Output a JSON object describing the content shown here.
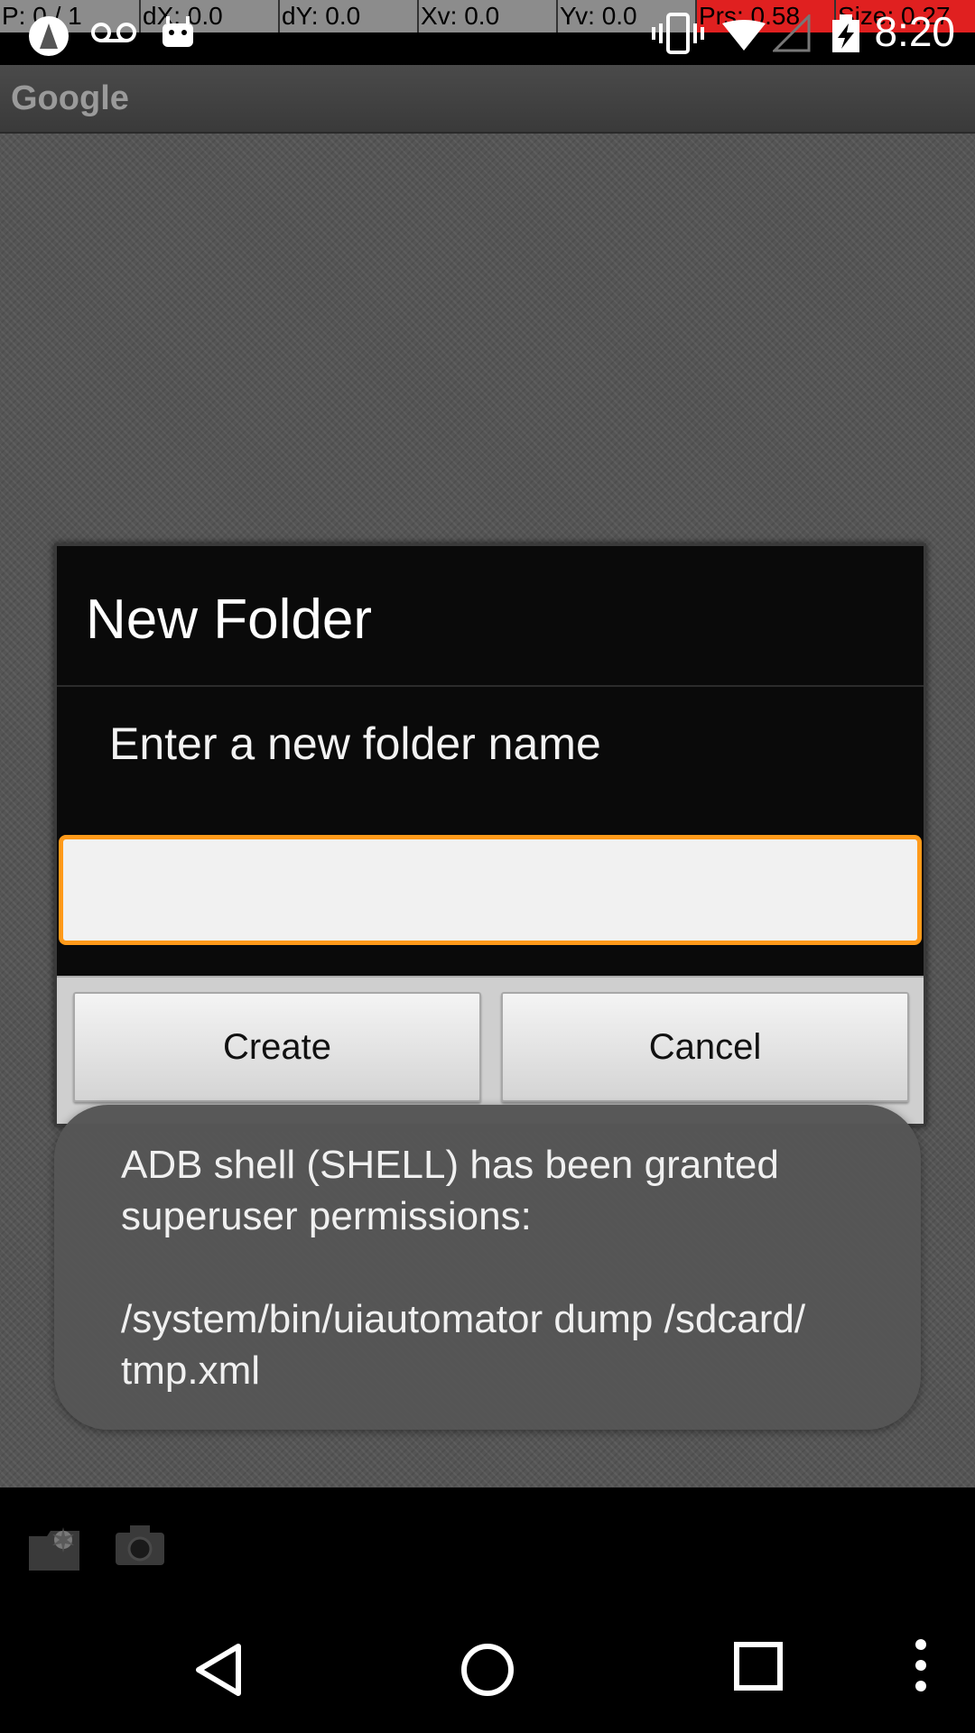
{
  "debug": {
    "p": "P: 0 / 1",
    "dx": "dX: 0.0",
    "dy": "dY: 0.0",
    "xv": "Xv: 0.0",
    "yv": "Yv: 0.0",
    "prs": "Prs: 0.58",
    "size": "Size: 0.27"
  },
  "status": {
    "time": "8:20",
    "left_icons": [
      "android-debug-icon",
      "voicemail-icon",
      "android-icon"
    ],
    "right_icons": [
      "vibrate-icon",
      "wifi-icon",
      "signal-icon",
      "battery-charging-icon"
    ]
  },
  "app": {
    "title": "Google"
  },
  "dialog": {
    "title": "New Folder",
    "message": "Enter a new folder name",
    "input_value": "",
    "accent_color": "#ff9a1a",
    "buttons": {
      "create": "Create",
      "cancel": "Cancel"
    }
  },
  "toast": {
    "text": "ADB shell (SHELL) has been granted\nsuperuser permissions:\n\n/system/bin/uiautomator dump /sdcard/\ntmp.xml"
  },
  "toolbar": {
    "icons": [
      "new-folder-icon",
      "camera-icon"
    ]
  },
  "nav": {
    "icons": [
      "back-icon",
      "home-icon",
      "recents-icon",
      "overflow-menu-icon"
    ]
  }
}
